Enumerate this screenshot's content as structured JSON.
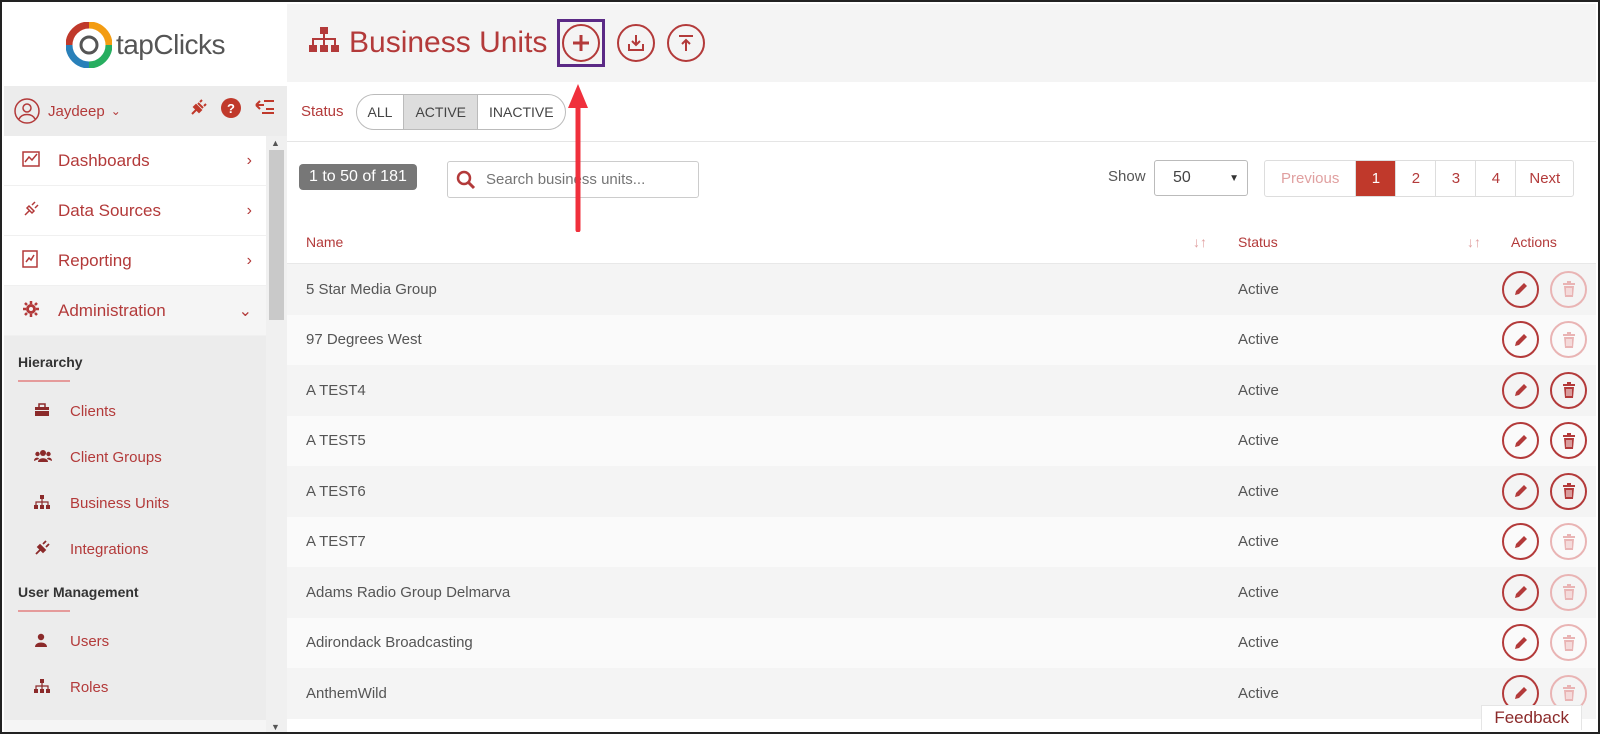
{
  "brand": {
    "name_tap": "tap",
    "name_clicks": "Clicks"
  },
  "user": {
    "name": "Jaydeep"
  },
  "nav": [
    {
      "label": "Dashboards",
      "icon": "chart-line-icon"
    },
    {
      "label": "Data Sources",
      "icon": "plug-icon"
    },
    {
      "label": "Reporting",
      "icon": "report-icon"
    },
    {
      "label": "Administration",
      "icon": "gear-icon",
      "expanded": true
    }
  ],
  "hierarchy": {
    "heading": "Hierarchy",
    "items": [
      {
        "label": "Clients",
        "icon": "briefcase-icon"
      },
      {
        "label": "Client Groups",
        "icon": "users-icon"
      },
      {
        "label": "Business Units",
        "icon": "sitemap-icon"
      },
      {
        "label": "Integrations",
        "icon": "plug-icon"
      }
    ]
  },
  "user_management": {
    "heading": "User Management",
    "items": [
      {
        "label": "Users",
        "icon": "user-icon"
      },
      {
        "label": "Roles",
        "icon": "sitemap-icon"
      }
    ]
  },
  "header": {
    "title": "Business Units"
  },
  "status_filter": {
    "label": "Status",
    "options": [
      "ALL",
      "ACTIVE",
      "INACTIVE"
    ],
    "selected": "ACTIVE"
  },
  "toolbar": {
    "count": "1 to 50 of 181",
    "search_placeholder": "Search business units...",
    "show_label": "Show",
    "show_value": "50"
  },
  "pager": {
    "previous": "Previous",
    "pages": [
      "1",
      "2",
      "3",
      "4"
    ],
    "current": "1",
    "next": "Next"
  },
  "table": {
    "columns": {
      "name": "Name",
      "status": "Status",
      "actions": "Actions"
    },
    "rows": [
      {
        "name": "5 Star Media Group",
        "status": "Active",
        "delete_enabled": false
      },
      {
        "name": "97 Degrees West",
        "status": "Active",
        "delete_enabled": false
      },
      {
        "name": "A TEST4",
        "status": "Active",
        "delete_enabled": true
      },
      {
        "name": "A TEST5",
        "status": "Active",
        "delete_enabled": true
      },
      {
        "name": "A TEST6",
        "status": "Active",
        "delete_enabled": true
      },
      {
        "name": "A TEST7",
        "status": "Active",
        "delete_enabled": false
      },
      {
        "name": "Adams Radio Group Delmarva",
        "status": "Active",
        "delete_enabled": false
      },
      {
        "name": "Adirondack Broadcasting",
        "status": "Active",
        "delete_enabled": false
      },
      {
        "name": "AnthemWild",
        "status": "Active",
        "delete_enabled": false
      }
    ]
  },
  "feedback": "Feedback",
  "colors": {
    "accent": "#b33a3a",
    "highlight_box": "#5b2a86",
    "arrow": "#f0303c"
  }
}
